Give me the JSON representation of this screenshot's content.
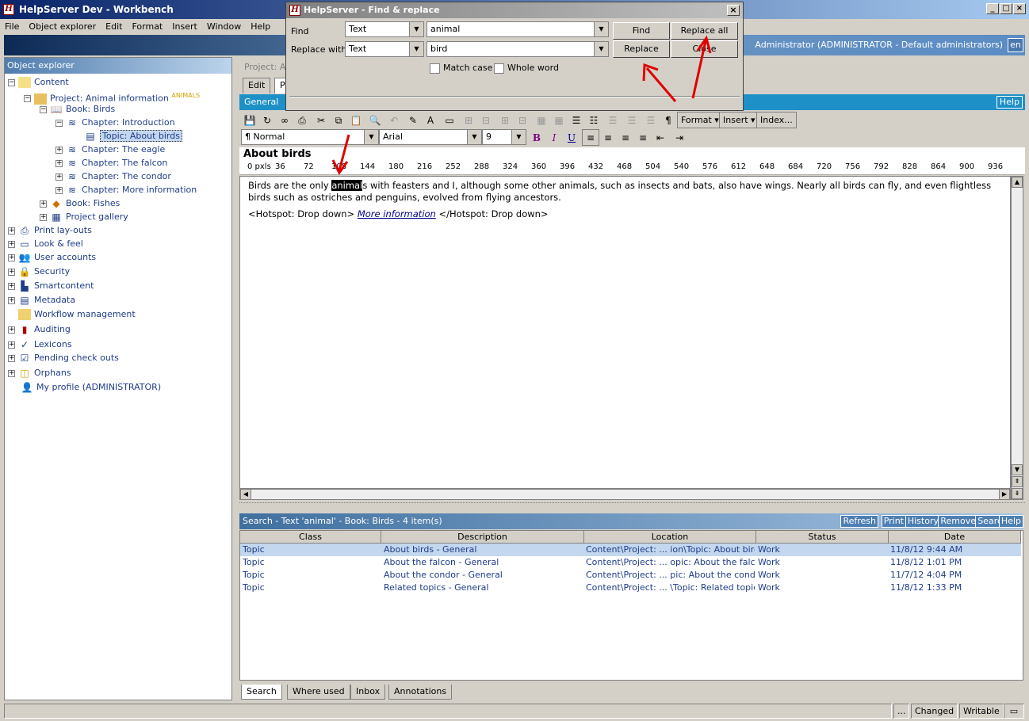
{
  "window": {
    "title": "HelpServer Dev - Workbench",
    "min": "_",
    "max": "□",
    "close": "×"
  },
  "menu": [
    "File",
    "Object explorer",
    "Edit",
    "Format",
    "Insert",
    "Window",
    "Help"
  ],
  "banner": {
    "user": "Administrator (ADMINISTRATOR - Default administrators)",
    "lang": "en"
  },
  "explorer": {
    "title": "Object explorer",
    "items": [
      {
        "label": "Content",
        "icon": "folder-icon"
      },
      {
        "label": "Project: Animal information",
        "tag": "ANIMALS",
        "icon": "project-icon"
      },
      {
        "label": "Book: Birds",
        "icon": "book-icon"
      },
      {
        "label": "Chapter: Introduction",
        "icon": "chapter-icon"
      },
      {
        "label": "Topic: About birds",
        "icon": "topic-icon"
      },
      {
        "label": "Chapter: The eagle",
        "icon": "chapter-icon"
      },
      {
        "label": "Chapter: The falcon",
        "icon": "chapter-icon"
      },
      {
        "label": "Chapter: The condor",
        "icon": "chapter-icon"
      },
      {
        "label": "Chapter: More information",
        "icon": "chapter-icon"
      },
      {
        "label": "Book: Fishes",
        "icon": "book-icon"
      },
      {
        "label": "Project gallery",
        "icon": "gallery-icon"
      },
      {
        "label": "Print lay-outs",
        "icon": "printer-icon"
      },
      {
        "label": "Look & feel",
        "icon": "monitor-icon"
      },
      {
        "label": "User accounts",
        "icon": "users-icon"
      },
      {
        "label": "Security",
        "icon": "lock-icon"
      },
      {
        "label": "Smartcontent",
        "icon": "smartcontent-icon"
      },
      {
        "label": "Metadata",
        "icon": "metadata-icon"
      },
      {
        "label": "Workflow management",
        "icon": "workflow-icon"
      },
      {
        "label": "Auditing",
        "icon": "chart-icon"
      },
      {
        "label": "Lexicons",
        "icon": "spellcheck-icon"
      },
      {
        "label": "Pending check outs",
        "icon": "checkout-icon"
      },
      {
        "label": "Orphans",
        "icon": "orphans-icon"
      },
      {
        "label": "My profile (ADMINISTRATOR)",
        "icon": "person-icon"
      }
    ]
  },
  "editor_header": {
    "project_crumb": "Project: An",
    "tab_edit": "Edit",
    "tab_p": "P",
    "general": "General",
    "help": "Help"
  },
  "toolbar": {
    "format": "Format",
    "insert": "Insert",
    "index": "Index..."
  },
  "formatbar": {
    "style": "Normal",
    "font": "Arial",
    "size": "9",
    "bold": "B",
    "italic": "I",
    "underline": "U"
  },
  "document": {
    "title": "About birds",
    "ruler": [
      "0 pxls",
      "36",
      "72",
      "108",
      "144",
      "180",
      "216",
      "252",
      "288",
      "324",
      "360",
      "396",
      "432",
      "468",
      "504",
      "540",
      "576",
      "612",
      "648",
      "684",
      "720",
      "756",
      "792",
      "828",
      "864",
      "900",
      "936"
    ],
    "p1_before": "Birds are the only ",
    "p1_hl": "animal",
    "p1_after": "s with feasters and I, although some other animals, such as insects and bats, also have wings. Nearly all birds can fly, and even flightless birds such as ostriches and penguins, evolved from flying ancestors.",
    "hotspot_open": "<Hotspot: Drop down>",
    "hotspot_link": "More information",
    "hotspot_close": "</Hotspot: Drop down>"
  },
  "search": {
    "title": "Search - Text 'animal' - Book: Birds - 4 item(s)",
    "buttons": [
      "Refresh",
      "Print",
      "History",
      "Remove",
      "Search",
      "Help"
    ],
    "columns": [
      "Class",
      "Description",
      "Location",
      "Status",
      "Date"
    ],
    "rows": [
      [
        "Topic",
        "About birds - General",
        "Content\\Project:  ... ion\\Topic: About birds",
        "Work",
        "11/8/12 9:44 AM"
      ],
      [
        "Topic",
        "About the falcon - General",
        "Content\\Project:  ... opic: About the falcon",
        "Work",
        "11/8/12 1:01 PM"
      ],
      [
        "Topic",
        "About the condor - General",
        "Content\\Project:  ... pic: About the condor",
        "Work",
        "11/7/12 4:04 PM"
      ],
      [
        "Topic",
        "Related topics - General",
        "Content\\Project:  ... \\Topic: Related topics",
        "Work",
        "11/8/12 1:33 PM"
      ]
    ]
  },
  "bottom_tabs": [
    "Search",
    "Where used",
    "Inbox",
    "Annotations"
  ],
  "status": {
    "dots": "...",
    "changed": "Changed",
    "writable": "Writable"
  },
  "dialog": {
    "title": "HelpServer - Find & replace",
    "find_label": "Find",
    "replace_label": "Replace with",
    "find_type": "Text",
    "replace_type": "Text",
    "find_value": "animal",
    "replace_value": "bird",
    "btn_find": "Find",
    "btn_replace_all": "Replace all",
    "btn_replace": "Replace",
    "btn_close": "Close",
    "match_case": "Match case",
    "whole_word": "Whole word"
  }
}
